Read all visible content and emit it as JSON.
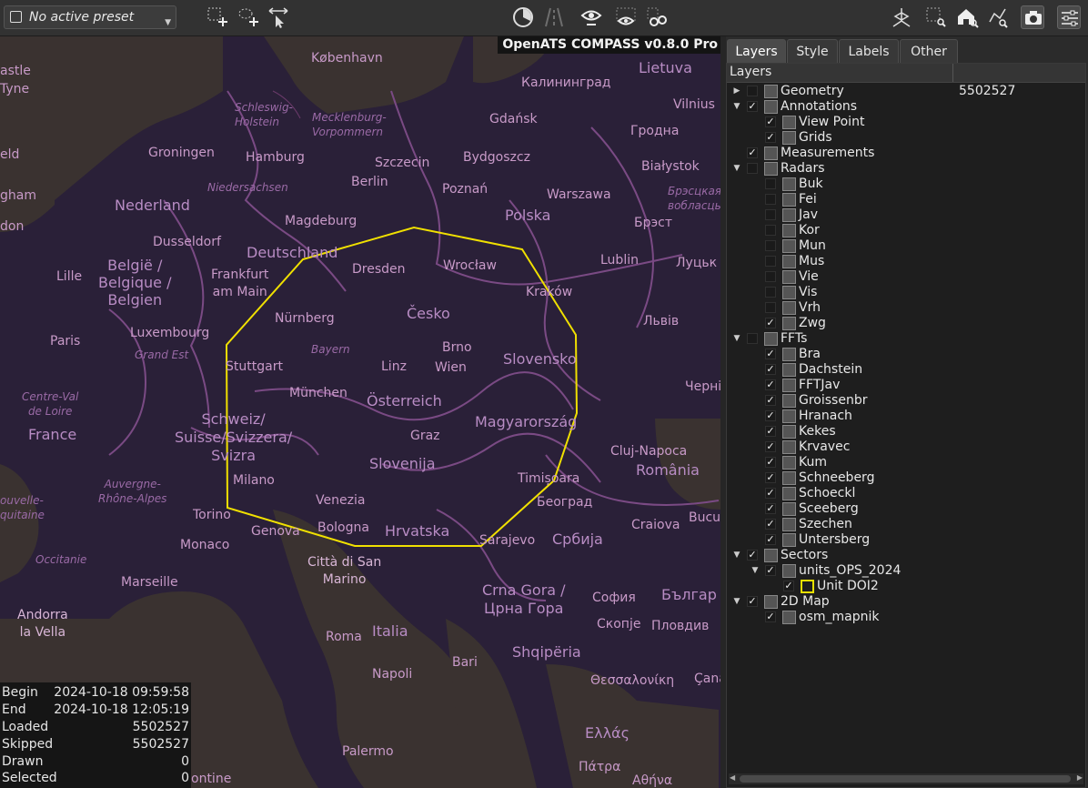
{
  "preset": {
    "label": "No active preset"
  },
  "map": {
    "title": "OpenATS COMPASS v0.8.0 Pro",
    "labels": {
      "astle": "astle",
      "tyne": "Tyne",
      "eld": "eld",
      "gham": "gham",
      "don": "don",
      "kobenhavn": "København",
      "schleswig": "Schleswig-\nHolstein",
      "mecklenburg": "Mecklenburg-\nVorpommern",
      "gdansk": "Gdańsk",
      "kaliningrad": "Калининград",
      "lietuva": "Lietuva",
      "vilnius": "Vilnius",
      "groningen": "Groningen",
      "hamburg": "Hamburg",
      "szczecin": "Szczecin",
      "bydgoszcz": "Bydgoszcz",
      "grodna": "Гродна",
      "bialystok": "Białystok",
      "niedersachsen": "Niedersachsen",
      "berlin": "Berlin",
      "poznan": "Poznań",
      "warszawa": "Warszawa",
      "brestvob": "Брэсцкая\nвобласць",
      "nederland": "Nederland",
      "magdeburg": "Magdeburg",
      "polska": "Polska",
      "brest": "Брэст",
      "dusseldorf": "Dusseldorf",
      "deutschland": "Deutschland",
      "belgie": "België /\nBelgique /\nBelgien",
      "lille": "Lille",
      "frankfurt": "Frankfurt\nam Main",
      "dresden": "Dresden",
      "wroclaw": "Wrocław",
      "lublin": "Lublin",
      "lutsk": "Луцьк",
      "krakow": "Kraków",
      "cesko": "Česko",
      "nurnberg": "Nürnberg",
      "luxembourg": "Luxembourg",
      "lviv": "Львів",
      "paris": "Paris",
      "grandest": "Grand Est",
      "bayern": "Bayern",
      "brno": "Brno",
      "stuttgart": "Stuttgart",
      "linz": "Linz",
      "wien": "Wien",
      "slovensko": "Slovensko",
      "centreval": "Centre-Val\nde Loire",
      "munchen": "München",
      "osterreich": "Österreich",
      "cherni": "Черні",
      "schweiz": "Schweiz/\nSuisse/Svizzera/\nSvizra",
      "magyar": "Magyarország",
      "france": "France",
      "graz": "Graz",
      "cluj": "Cluj-Napoca",
      "slovenija": "Slovenija",
      "romania": "România",
      "timisoara": "Timișoara",
      "milano": "Milano",
      "auvergne": "Auvergne-\nRhône-Alpes",
      "velle": "ouvelle-\nquitaine",
      "venezia": "Venezia",
      "beograd": "Београд",
      "torino": "Torino",
      "bucu": "Bucu",
      "genova": "Genova",
      "bologna": "Bologna",
      "hrvatska": "Hrvatska",
      "craiova": "Craiova",
      "monaco": "Monaco",
      "sarajevo": "Sarajevo",
      "srbija": "Србија",
      "occitanie": "Occitanie",
      "cittadisan": "Città di San\nMarino",
      "marseille": "Marseille",
      "crnagora": "Crna Gora /\nЦрна Гора",
      "sofia": "София",
      "balg": "Българ",
      "andorra": "Andorra\nla Vella",
      "skopje": "Скопје",
      "plovdiv": "Пловдив",
      "roma": "Roma",
      "italia": "Italia",
      "shqiperia": "Shqipëria",
      "bari": "Bari",
      "napoli": "Napoli",
      "thessaloniki": "Θεσσαλονίκη",
      "cana": "Çana",
      "ellas": "Ελλάς",
      "palermo": "Palermo",
      "patra": "Πάτρα",
      "athina": "Αθήνα",
      "ontine": "ontine"
    },
    "stats": [
      {
        "key": "Begin",
        "value": "2024-10-18 09:59:58"
      },
      {
        "key": "End",
        "value": "2024-10-18 12:05:19"
      },
      {
        "key": "Loaded",
        "value": "5502527"
      },
      {
        "key": "Skipped",
        "value": "5502527"
      },
      {
        "key": "Drawn",
        "value": "0"
      },
      {
        "key": "Selected",
        "value": "0"
      }
    ],
    "sector_color": "#f0e000"
  },
  "panel": {
    "tabs": [
      "Layers",
      "Style",
      "Labels",
      "Other"
    ],
    "tree_header": "Layers",
    "tree": [
      {
        "label": "Geometry",
        "value": "5502527",
        "checked": false
      },
      {
        "label": "Annotations",
        "checked": true
      },
      {
        "label": "View Point",
        "checked": true
      },
      {
        "label": "Grids",
        "checked": true
      },
      {
        "label": "Measurements",
        "checked": true
      },
      {
        "label": "Radars",
        "checked": false
      },
      {
        "label": "Buk",
        "checked": false
      },
      {
        "label": "Fei",
        "checked": false
      },
      {
        "label": "Jav",
        "checked": false
      },
      {
        "label": "Kor",
        "checked": false
      },
      {
        "label": "Mun",
        "checked": false
      },
      {
        "label": "Mus",
        "checked": false
      },
      {
        "label": "Vie",
        "checked": false
      },
      {
        "label": "Vis",
        "checked": false
      },
      {
        "label": "Vrh",
        "checked": false
      },
      {
        "label": "Zwg",
        "checked": true
      },
      {
        "label": "FFTs",
        "checked": false
      },
      {
        "label": "Bra",
        "checked": true
      },
      {
        "label": "Dachstein",
        "checked": true
      },
      {
        "label": "FFTJav",
        "checked": true
      },
      {
        "label": "Groissenbr",
        "checked": true
      },
      {
        "label": "Hranach",
        "checked": true
      },
      {
        "label": "Kekes",
        "checked": true
      },
      {
        "label": "Krvavec",
        "checked": true
      },
      {
        "label": "Kum",
        "checked": true
      },
      {
        "label": "Schneeberg",
        "checked": true
      },
      {
        "label": "Schoeckl",
        "checked": true
      },
      {
        "label": "Sceeberg",
        "checked": true
      },
      {
        "label": "Szechen",
        "checked": true
      },
      {
        "label": "Untersberg",
        "checked": true
      },
      {
        "label": "Sectors",
        "checked": true
      },
      {
        "label": "units_OPS_2024",
        "checked": true
      },
      {
        "label": "Unit DOI2",
        "checked": true
      },
      {
        "label": "2D Map",
        "checked": true
      },
      {
        "label": "osm_mapnik",
        "checked": true
      }
    ]
  }
}
